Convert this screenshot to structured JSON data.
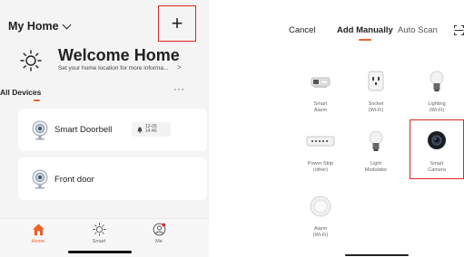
{
  "left": {
    "home_selector": "My Home",
    "add_label": "+",
    "welcome_title": "Welcome Home",
    "welcome_subtitle": "Set your home location for more informa...",
    "welcome_arrow": ">",
    "all_devices": "All Devices",
    "more": "···",
    "devices": [
      {
        "name": "Smart Doorbell",
        "badge_date": "12-05",
        "badge_time": "14:40"
      },
      {
        "name": "Front door"
      }
    ],
    "tabs": [
      {
        "label": "Home",
        "icon": "home-icon",
        "active": true
      },
      {
        "label": "Smart",
        "icon": "sun-icon",
        "active": false
      },
      {
        "label": "Me",
        "icon": "user-icon",
        "active": false
      }
    ]
  },
  "right": {
    "cancel": "Cancel",
    "add_manually": "Add Manually",
    "auto_scan": "Auto Scan",
    "categories": [
      {
        "label": "Smart",
        "sub": "Alarm",
        "icon": "alarm-device-icon"
      },
      {
        "label": "Socket",
        "sub": "(Wi-Fi)",
        "icon": "socket-icon"
      },
      {
        "label": "Lighting",
        "sub": "(Wi-Fi)",
        "icon": "bulb-icon"
      },
      {
        "label": "Power Strip",
        "sub": "(other)",
        "icon": "power-strip-icon"
      },
      {
        "label": "Light",
        "sub": "Modulator",
        "icon": "bulb-icon"
      },
      {
        "label": "Smart",
        "sub": "Camera",
        "icon": "camera-icon"
      },
      {
        "label": "Alarm",
        "sub": "(Wi-Fi)",
        "icon": "alarm-sensor-icon"
      }
    ]
  },
  "colors": {
    "accent": "#e8612b",
    "highlight": "#e0271f"
  }
}
